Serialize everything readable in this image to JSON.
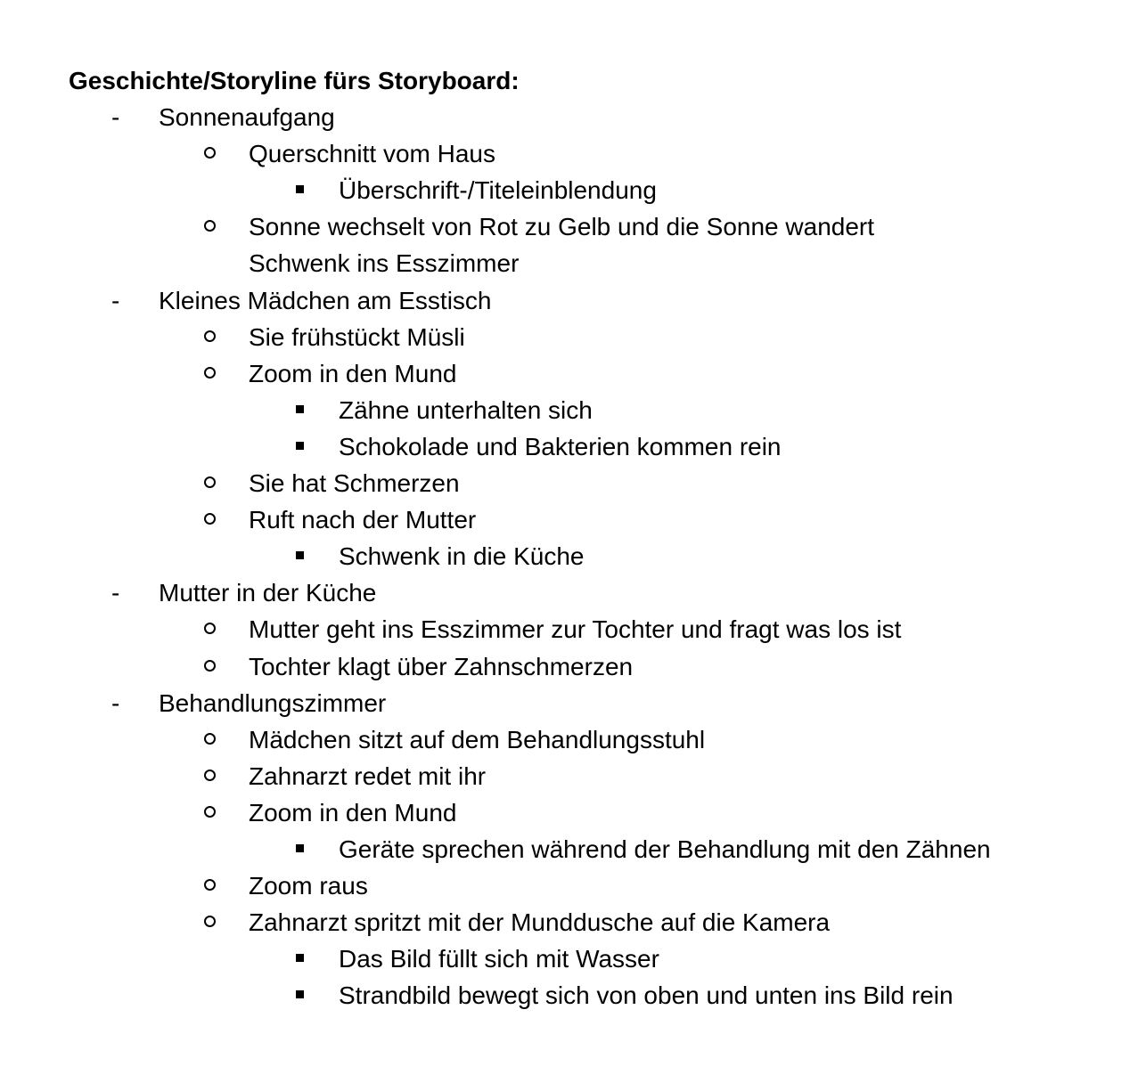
{
  "document": {
    "title": "Geschichte/Storyline fürs Storyboard:",
    "dash_marker": "-",
    "lines": [
      {
        "level": 1,
        "text": "Sonnenaufgang"
      },
      {
        "level": 2,
        "text": "Querschnitt vom Haus"
      },
      {
        "level": 3,
        "text": "Überschrift-/Titeleinblendung"
      },
      {
        "level": 2,
        "text": "Sonne wechselt von Rot zu Gelb und die Sonne wandert"
      },
      {
        "level": 0,
        "text": "Schwenk ins Esszimmer"
      },
      {
        "level": 1,
        "text": "Kleines Mädchen am Esstisch"
      },
      {
        "level": 2,
        "text": "Sie frühstückt Müsli"
      },
      {
        "level": 2,
        "text": "Zoom in den Mund"
      },
      {
        "level": 3,
        "text": "Zähne unterhalten sich"
      },
      {
        "level": 3,
        "text": "Schokolade und Bakterien kommen rein"
      },
      {
        "level": 2,
        "text": "Sie hat Schmerzen"
      },
      {
        "level": 2,
        "text": "Ruft nach der Mutter"
      },
      {
        "level": 3,
        "text": "Schwenk in die Küche"
      },
      {
        "level": 1,
        "text": "Mutter in der Küche"
      },
      {
        "level": 2,
        "text": "Mutter geht ins Esszimmer zur Tochter und fragt was los ist"
      },
      {
        "level": 2,
        "text": "Tochter klagt über Zahnschmerzen"
      },
      {
        "level": 1,
        "text": "Behandlungszimmer"
      },
      {
        "level": 2,
        "text": "Mädchen sitzt auf dem Behandlungsstuhl"
      },
      {
        "level": 2,
        "text": "Zahnarzt redet mit ihr"
      },
      {
        "level": 2,
        "text": "Zoom in den Mund"
      },
      {
        "level": 3,
        "text": "Geräte sprechen während der Behandlung mit den Zähnen"
      },
      {
        "level": 2,
        "text": "Zoom raus"
      },
      {
        "level": 2,
        "text": "Zahnarzt spritzt mit der Munddusche auf die Kamera"
      },
      {
        "level": 3,
        "text": "Das Bild füllt sich mit Wasser"
      },
      {
        "level": 3,
        "text": "Strandbild bewegt sich von oben und unten ins Bild rein"
      }
    ]
  }
}
